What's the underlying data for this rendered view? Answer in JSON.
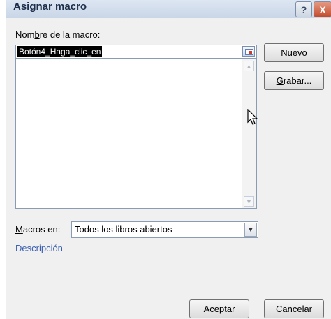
{
  "window": {
    "title": "Asignar macro",
    "help_glyph": "?",
    "close_glyph": "X"
  },
  "macro_name": {
    "label_pre": "Nom",
    "label_mnemonic": "b",
    "label_post": "re de la macro:",
    "value": "Botón4_Haga_clic_en"
  },
  "macro_list": {
    "items": [],
    "scroll_up_glyph": "▲",
    "scroll_down_glyph": "▼"
  },
  "buttons": {
    "nuevo": {
      "mnemonic": "N",
      "rest": "uevo"
    },
    "grabar": {
      "mnemonic": "G",
      "rest": "rabar..."
    },
    "aceptar": "Aceptar",
    "cancelar": "Cancelar"
  },
  "macros_in": {
    "label_mnemonic": "M",
    "label_post": "acros en:",
    "selected": "Todos los libros abiertos",
    "arrow_glyph": "▼"
  },
  "description": {
    "label": "Descripción"
  }
}
